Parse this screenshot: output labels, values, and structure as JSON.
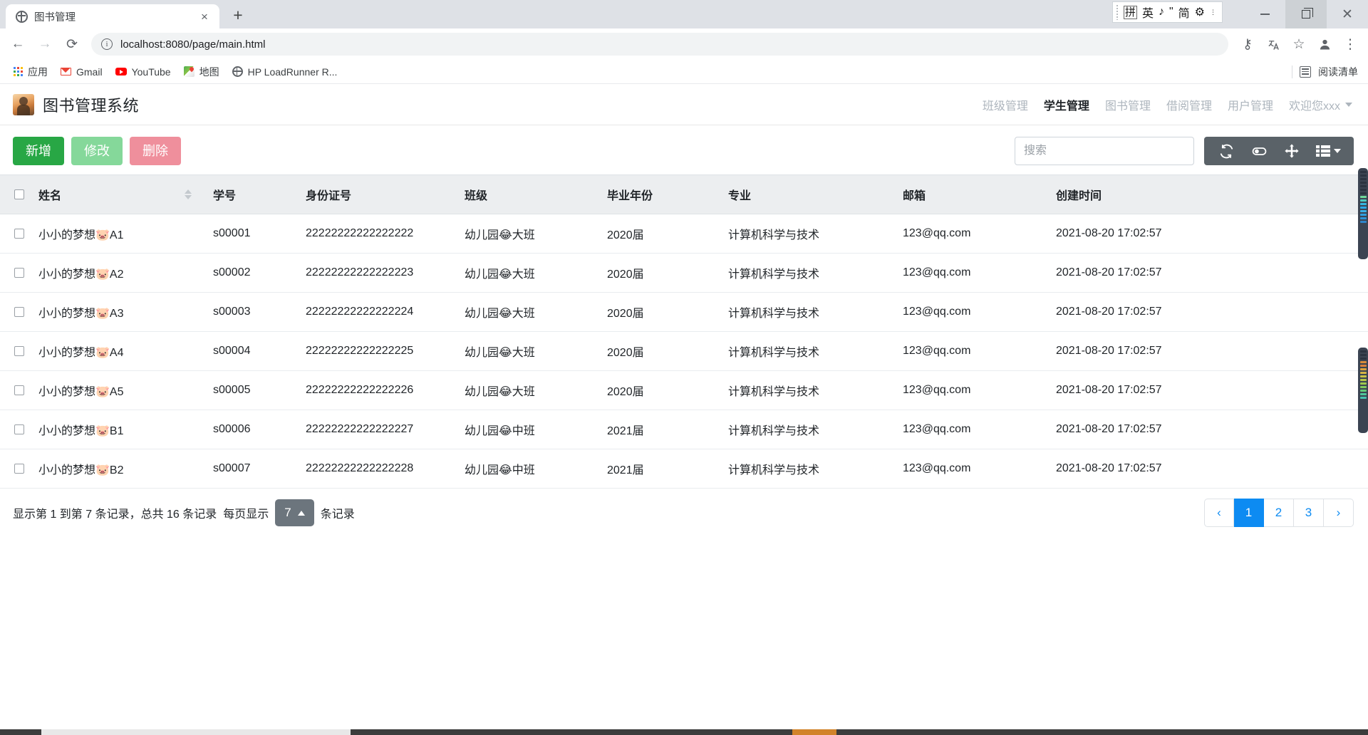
{
  "browser": {
    "tab": {
      "title": "图书管理",
      "favicon": "globe-icon",
      "close": "×"
    },
    "new_tab": "+",
    "nav": {
      "back": "←",
      "forward": "→",
      "reload": "⟳"
    },
    "omnibox": {
      "info_icon": "ⓘ",
      "url": "localhost:8080/page/main.html"
    },
    "toolbar_right": {
      "key_icon": "⚷",
      "translate_icon": "文",
      "star_icon": "☆",
      "profile_icon": "person-icon",
      "menu_icon": "⋮"
    },
    "bookmarks": [
      {
        "label": "应用",
        "icon": "apps-grid-icon"
      },
      {
        "label": "Gmail",
        "icon": "gmail-icon"
      },
      {
        "label": "YouTube",
        "icon": "youtube-icon"
      },
      {
        "label": "地图",
        "icon": "maps-icon"
      },
      {
        "label": "HP LoadRunner R...",
        "icon": "globe-icon"
      }
    ],
    "reading_list": {
      "label": "阅读清单",
      "icon": "reading-list-icon"
    },
    "ime": {
      "items": [
        "拼",
        "英",
        "♪",
        "\"",
        "简"
      ],
      "gear": "⚙",
      "caret": "⌄"
    },
    "window_controls": {
      "minimize": "—",
      "restore": "❐",
      "close": "✕"
    }
  },
  "app": {
    "brand": {
      "title": "图书管理系统",
      "logo": "avatar-photo"
    },
    "nav": [
      {
        "label": "班级管理",
        "active": false
      },
      {
        "label": "学生管理",
        "active": true
      },
      {
        "label": "图书管理",
        "active": false
      },
      {
        "label": "借阅管理",
        "active": false
      },
      {
        "label": "用户管理",
        "active": false
      }
    ],
    "user_menu": {
      "label": "欢迎您xxx",
      "caret": "▼"
    }
  },
  "toolbar": {
    "add_label": "新增",
    "edit_label": "修改",
    "delete_label": "删除",
    "search_placeholder": "搜索",
    "search_value": "",
    "icons": {
      "refresh": "refresh-icon",
      "toggle": "toggle-view-icon",
      "fullscreen": "fullscreen-icon",
      "columns": "columns-icon"
    }
  },
  "table": {
    "columns": [
      {
        "key": "checkbox",
        "label": ""
      },
      {
        "key": "name",
        "label": "姓名",
        "sortable": true
      },
      {
        "key": "sno",
        "label": "学号"
      },
      {
        "key": "idcard",
        "label": "身份证号"
      },
      {
        "key": "clazz",
        "label": "班级"
      },
      {
        "key": "gradyear",
        "label": "毕业年份"
      },
      {
        "key": "major",
        "label": "专业"
      },
      {
        "key": "email",
        "label": "邮箱"
      },
      {
        "key": "created",
        "label": "创建时间"
      }
    ],
    "rows": [
      {
        "name": "小小的梦想🐷A1",
        "sno": "s00001",
        "idcard": "22222222222222222",
        "clazz": "幼儿园😂大班",
        "gradyear": "2020届",
        "major": "计算机科学与技术",
        "email": "123@qq.com",
        "created": "2021-08-20 17:02:57"
      },
      {
        "name": "小小的梦想🐷A2",
        "sno": "s00002",
        "idcard": "22222222222222223",
        "clazz": "幼儿园😂大班",
        "gradyear": "2020届",
        "major": "计算机科学与技术",
        "email": "123@qq.com",
        "created": "2021-08-20 17:02:57"
      },
      {
        "name": "小小的梦想🐷A3",
        "sno": "s00003",
        "idcard": "22222222222222224",
        "clazz": "幼儿园😂大班",
        "gradyear": "2020届",
        "major": "计算机科学与技术",
        "email": "123@qq.com",
        "created": "2021-08-20 17:02:57"
      },
      {
        "name": "小小的梦想🐷A4",
        "sno": "s00004",
        "idcard": "22222222222222225",
        "clazz": "幼儿园😂大班",
        "gradyear": "2020届",
        "major": "计算机科学与技术",
        "email": "123@qq.com",
        "created": "2021-08-20 17:02:57"
      },
      {
        "name": "小小的梦想🐷A5",
        "sno": "s00005",
        "idcard": "22222222222222226",
        "clazz": "幼儿园😂大班",
        "gradyear": "2020届",
        "major": "计算机科学与技术",
        "email": "123@qq.com",
        "created": "2021-08-20 17:02:57"
      },
      {
        "name": "小小的梦想🐷B1",
        "sno": "s00006",
        "idcard": "22222222222222227",
        "clazz": "幼儿园😂中班",
        "gradyear": "2021届",
        "major": "计算机科学与技术",
        "email": "123@qq.com",
        "created": "2021-08-20 17:02:57"
      },
      {
        "name": "小小的梦想🐷B2",
        "sno": "s00007",
        "idcard": "22222222222222228",
        "clazz": "幼儿园😂中班",
        "gradyear": "2021届",
        "major": "计算机科学与技术",
        "email": "123@qq.com",
        "created": "2021-08-20 17:02:57"
      }
    ]
  },
  "footer": {
    "summary_prefix": "显示第 1 到第 7 条记录，总共 16 条记录",
    "per_page_label": "每页显示",
    "per_page_value": "7",
    "per_page_caret": "▲",
    "records_suffix": "条记录",
    "pager": {
      "prev": "‹",
      "next": "›",
      "pages": [
        "1",
        "2",
        "3"
      ],
      "active_page": "1",
      "active_color": "#0d8bf2"
    }
  },
  "colors": {
    "primary_green": "#28a745",
    "muted_green": "#85d89a",
    "muted_red": "#ef8f9c",
    "toolbar_gray": "#5a6268",
    "accent_blue": "#0d8bf2",
    "header_gray": "#eceef0"
  }
}
